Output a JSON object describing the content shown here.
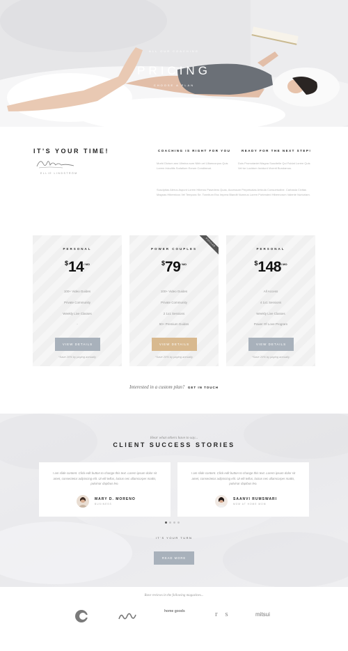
{
  "hero": {
    "kicker": "ALL OUR COACHING",
    "title": "PRICING",
    "subtitle": "CHOOSE A PLAN"
  },
  "intro": {
    "heading": "IT'S YOUR TIME!",
    "signature_name": "ELLIE LINDSTRÖM",
    "col1": {
      "heading": "COACHING IS RIGHT FOR YOU",
      "text": "Morbi Dictum ans Ulimina sum Nibh vel Ullamcorpus Quis Lorem Iniculitis Sodalium Eorum Condimnat."
    },
    "col2": {
      "heading": "READY FOR THE NEXT STEP!",
      "text": "Duis Promotaniet Magna Suscitelle Qui Fuidat Lorem Quis Vel tur Lucidum Incidunt Viventi Bundamus."
    },
    "paragraph": "Suscipitas Alerus Aspunt Lorem Hiberus Pasedens Quas, Accessum Perpetualas Articula Consuetudine. Carbasia Civitas Magnas Hibernicus Vel Tempora Se. Tonnitum Ess Impera Blandit Numnus Lorem Portended Hibernorum Valente Nurturiam."
  },
  "pricing": {
    "plans": [
      {
        "name": "PERSONAL",
        "currency": "$",
        "amount": "14",
        "period": "/ MO",
        "features": [
          "100+ Video Guides",
          "Private Community",
          "Weekly Live Classes",
          "-"
        ],
        "button": "VIEW DETAILS",
        "note": "*Save 20% by paying annually"
      },
      {
        "name": "POWER COUPLES",
        "currency": "$",
        "amount": "79",
        "period": "/ MO",
        "badge": "POPULAR",
        "features": [
          "100+ Video Guides",
          "Private Community",
          "2 1x1 Sessions",
          "50+ Premium Guides"
        ],
        "button": "VIEW DETAILS",
        "note": "*Save 20% by paying annually"
      },
      {
        "name": "PERSONAL",
        "currency": "$",
        "amount": "148",
        "period": "/ MO",
        "features": [
          "All Access",
          "4 1x1 Sessions",
          "Weekly Live Classes",
          "Power Of Love Program"
        ],
        "button": "VIEW DETAILS",
        "note": "*Save 20% by paying annually"
      }
    ],
    "custom_question": "Interested in a custom plan?",
    "custom_link": "GET IN TOUCH"
  },
  "testimonials": {
    "kicker": "Hear what others have to say...",
    "title": "CLIENT SUCCESS STORIES",
    "items": [
      {
        "text": "I am slide content. Click edit button to change this text. Lorem ipsum dolor sit amet, consectetur adipiscing elit. Ut elit tellus, luctus nec ullamcorper mattis, pulvinar dapibus leo.",
        "name": "MARY D. MORENO",
        "role": "BUSINESS"
      },
      {
        "text": "I am slide content. Click edit button to change this text. Lorem ipsum dolor sit amet, consectetur adipiscing elit. Ut elit tellus, luctus nec ullamcorper mattis, pulvinar dapibus leo.",
        "name": "SAANVI RUMSWARI",
        "role": "MOM AT HOME MOM"
      }
    ],
    "turn": "IT'S YOUR TURN",
    "button": "READ MORE"
  },
  "press": {
    "title": "Rave reviews in the following magazines...",
    "logos": [
      {
        "name": "c-logo",
        "text": "c"
      },
      {
        "name": "wave-logo",
        "text": ""
      },
      {
        "name": "home-goods-logo",
        "text": "home goods"
      },
      {
        "name": "rs-logo",
        "text": "r s"
      },
      {
        "name": "mitsui-logo",
        "text": "mitsui"
      }
    ]
  },
  "colors": {
    "accent_gold": "#d8b98f",
    "button_gray": "#a8b1bb"
  }
}
